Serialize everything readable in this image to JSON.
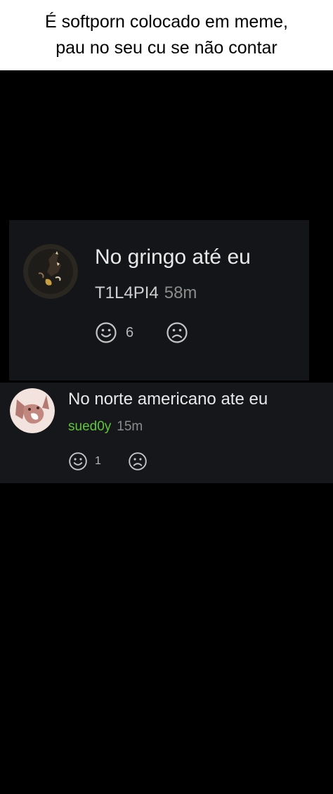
{
  "caption": {
    "line1": "É softporn colocado em meme,",
    "line2": "pau no seu cu se não contar"
  },
  "comments": [
    {
      "text": "No gringo até eu",
      "username": "T1L4PI4",
      "time": "58m",
      "like_count": "6",
      "username_color": "#d0d0d0"
    },
    {
      "text": "No norte americano ate eu",
      "username": "sued0y",
      "time": "15m",
      "like_count": "1",
      "username_color": "#5fc63a"
    }
  ],
  "icons": {
    "like": "smile-icon",
    "dislike": "frown-icon"
  }
}
